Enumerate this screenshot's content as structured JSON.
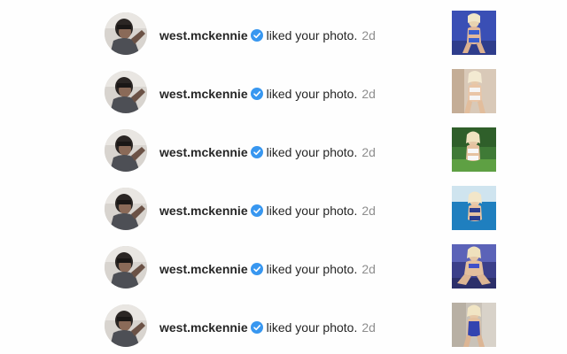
{
  "notifications": [
    {
      "username": "west.mckennie",
      "action": "liked your photo.",
      "time": "2d",
      "avatar_icon": "profile-photo",
      "verified_icon": "verified-badge-icon",
      "thumb_icon": "photo-thumbnail",
      "thumb_bg": "#3a4fb5"
    },
    {
      "username": "west.mckennie",
      "action": "liked your photo.",
      "time": "2d",
      "avatar_icon": "profile-photo",
      "verified_icon": "verified-badge-icon",
      "thumb_icon": "photo-thumbnail",
      "thumb_bg": "#d9c9b8"
    },
    {
      "username": "west.mckennie",
      "action": "liked your photo.",
      "time": "2d",
      "avatar_icon": "profile-photo",
      "verified_icon": "verified-badge-icon",
      "thumb_icon": "photo-thumbnail",
      "thumb_bg": "#3f7a36"
    },
    {
      "username": "west.mckennie",
      "action": "liked your photo.",
      "time": "2d",
      "avatar_icon": "profile-photo",
      "verified_icon": "verified-badge-icon",
      "thumb_icon": "photo-thumbnail",
      "thumb_bg": "#2a8fc9"
    },
    {
      "username": "west.mckennie",
      "action": "liked your photo.",
      "time": "2d",
      "avatar_icon": "profile-photo",
      "verified_icon": "verified-badge-icon",
      "thumb_icon": "photo-thumbnail",
      "thumb_bg": "#3b3f8a"
    },
    {
      "username": "west.mckennie",
      "action": "liked your photo.",
      "time": "2d",
      "avatar_icon": "profile-photo",
      "verified_icon": "verified-badge-icon",
      "thumb_icon": "photo-thumbnail",
      "thumb_bg": "#c9c2b8"
    }
  ],
  "colors": {
    "verified_blue": "#3897f0",
    "username_text": "#262626",
    "time_text": "#8e8e8e"
  }
}
